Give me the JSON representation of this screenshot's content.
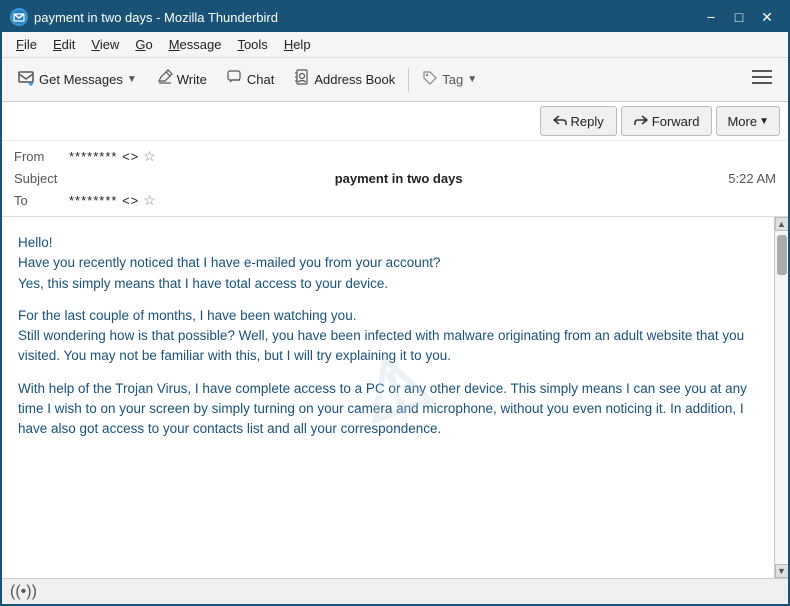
{
  "window": {
    "title": "payment in two days - Mozilla Thunderbird",
    "controls": {
      "minimize": "−",
      "maximize": "□",
      "close": "✕"
    }
  },
  "menu": {
    "items": [
      "File",
      "Edit",
      "View",
      "Go",
      "Message",
      "Tools",
      "Help"
    ]
  },
  "toolbar": {
    "get_messages_label": "Get Messages",
    "write_label": "Write",
    "chat_label": "Chat",
    "address_book_label": "Address Book",
    "tag_label": "Tag",
    "hamburger": "≡"
  },
  "email_actions": {
    "reply_label": "Reply",
    "forward_label": "Forward",
    "more_label": "More"
  },
  "email_header": {
    "from_label": "From",
    "from_value": "******** <>",
    "subject_label": "Subject",
    "subject_value": "payment in two days",
    "time_value": "5:22 AM",
    "to_label": "To",
    "to_value": "******** <>"
  },
  "email_body": {
    "paragraphs": [
      "Hello!\nHave you recently noticed that I have e-mailed you from your account?\nYes, this simply means that I have total access to your device.",
      "For the last couple of months, I have been watching you.\nStill wondering how is that possible? Well, you have been infected with malware originating from an adult website that you visited. You may not be familiar with this, but I will try explaining it to you.",
      "With help of the Trojan Virus, I have complete access to a PC or any other device. This simply means I can see you at any time I wish to on your screen by simply turning on your camera and microphone, without you even noticing it. In addition, I have also got access to your contacts list and all your correspondence."
    ],
    "watermark": "⚠"
  },
  "status_bar": {
    "icon": "((•))"
  }
}
